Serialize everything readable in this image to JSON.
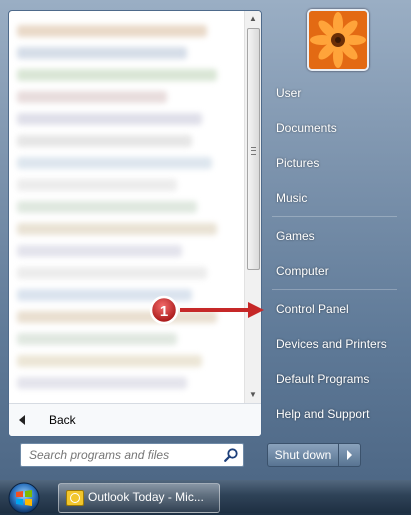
{
  "start_menu": {
    "back_label": "Back",
    "search": {
      "placeholder": "Search programs and files"
    },
    "right_items": [
      "User",
      "Documents",
      "Pictures",
      "Music",
      "Games",
      "Computer",
      "Control Panel",
      "Devices and Printers",
      "Default Programs",
      "Help and Support"
    ],
    "shutdown_label": "Shut down"
  },
  "taskbar": {
    "task_label": "Outlook Today - Mic..."
  },
  "annotation": {
    "step_number": "1",
    "color": "#c62828"
  },
  "colors": {
    "accent": "#5f7a98"
  }
}
